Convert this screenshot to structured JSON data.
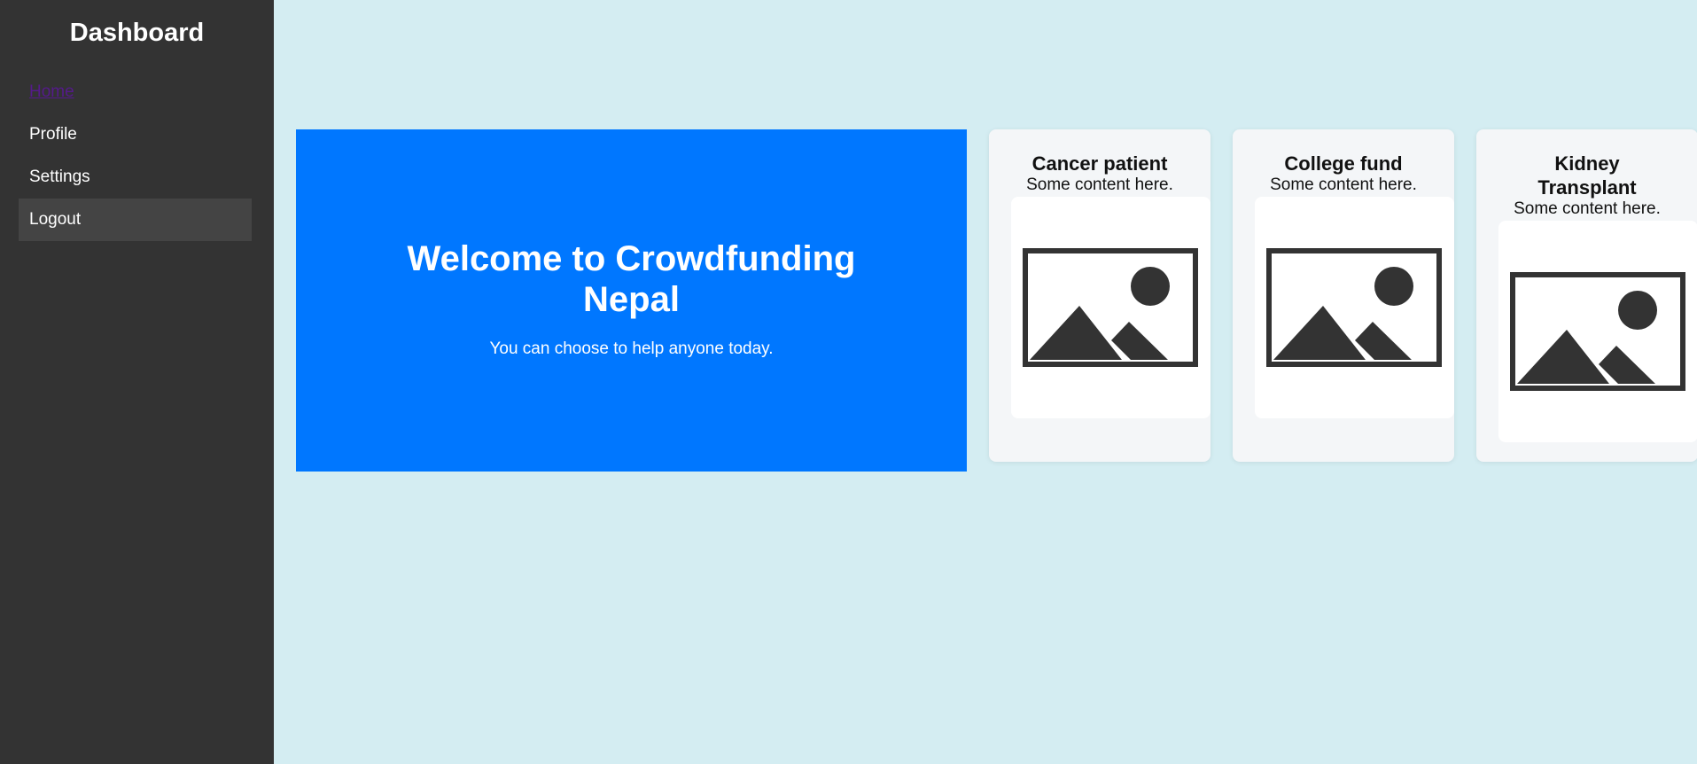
{
  "sidebar": {
    "title": "Dashboard",
    "items": [
      {
        "label": "Home"
      },
      {
        "label": "Profile"
      },
      {
        "label": "Settings"
      },
      {
        "label": "Logout"
      }
    ]
  },
  "hero": {
    "title": "Welcome to Crowdfunding Nepal",
    "subtitle": "You can choose to help anyone today.",
    "background_color": "#0077ff"
  },
  "cards": [
    {
      "title": "Cancer patient",
      "text": "Some content here.",
      "icon": "image-placeholder-icon"
    },
    {
      "title": "College fund",
      "text": "Some content here.",
      "icon": "image-placeholder-icon"
    },
    {
      "title": "Kidney Transplant",
      "text": "Some content here.",
      "icon": "image-placeholder-icon"
    }
  ],
  "colors": {
    "sidebar_bg": "#333333",
    "page_bg": "#d4edf2",
    "accent": "#0077ff"
  }
}
